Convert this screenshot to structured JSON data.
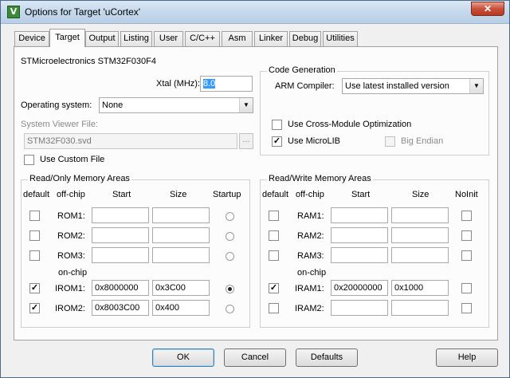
{
  "window": {
    "title": "Options for Target 'uCortex'",
    "icon": "keil-uvision-icon",
    "close_glyph": "✕"
  },
  "tabs": [
    {
      "label": "Device"
    },
    {
      "label": "Target"
    },
    {
      "label": "Output"
    },
    {
      "label": "Listing"
    },
    {
      "label": "User"
    },
    {
      "label": "C/C++"
    },
    {
      "label": "Asm"
    },
    {
      "label": "Linker"
    },
    {
      "label": "Debug"
    },
    {
      "label": "Utilities"
    }
  ],
  "active_tab": "Target",
  "target": {
    "device_name": "STMicroelectronics STM32F030F4",
    "xtal_label": "Xtal (MHz):",
    "xtal_value": "8.0",
    "os_label": "Operating system:",
    "os_value": "None",
    "svf_label": "System Viewer File:",
    "svf_value": "STM32F030.svd",
    "browse_label": "...",
    "custom_file_label": "Use Custom File",
    "custom_file_checked": false
  },
  "code_gen": {
    "title": "Code Generation",
    "compiler_label": "ARM Compiler:",
    "compiler_value": "Use latest installed version",
    "cross_module_label": "Use Cross-Module Optimization",
    "cross_module_checked": false,
    "microlib_label": "Use MicroLIB",
    "microlib_checked": true,
    "big_endian_label": "Big Endian",
    "big_endian_checked": false
  },
  "rom": {
    "title": "Read/Only Memory Areas",
    "headers": {
      "default": "default",
      "offchip": "off-chip",
      "start": "Start",
      "size": "Size",
      "startup": "Startup"
    },
    "onchip_label": "on-chip",
    "rows": [
      {
        "name": "ROM1:",
        "default": false,
        "start": "",
        "size": "",
        "startup": false
      },
      {
        "name": "ROM2:",
        "default": false,
        "start": "",
        "size": "",
        "startup": false
      },
      {
        "name": "ROM3:",
        "default": false,
        "start": "",
        "size": "",
        "startup": false
      },
      {
        "name": "IROM1:",
        "default": true,
        "start": "0x8000000",
        "size": "0x3C00",
        "startup": true
      },
      {
        "name": "IROM2:",
        "default": true,
        "start": "0x8003C00",
        "size": "0x400",
        "startup": false
      }
    ]
  },
  "ram": {
    "title": "Read/Write Memory Areas",
    "headers": {
      "default": "default",
      "offchip": "off-chip",
      "start": "Start",
      "size": "Size",
      "noinit": "NoInit"
    },
    "onchip_label": "on-chip",
    "rows": [
      {
        "name": "RAM1:",
        "default": false,
        "start": "",
        "size": "",
        "noinit": false
      },
      {
        "name": "RAM2:",
        "default": false,
        "start": "",
        "size": "",
        "noinit": false
      },
      {
        "name": "RAM3:",
        "default": false,
        "start": "",
        "size": "",
        "noinit": false
      },
      {
        "name": "IRAM1:",
        "default": true,
        "start": "0x20000000",
        "size": "0x1000",
        "noinit": false
      },
      {
        "name": "IRAM2:",
        "default": false,
        "start": "",
        "size": "",
        "noinit": false
      }
    ]
  },
  "buttons": {
    "ok": "OK",
    "cancel": "Cancel",
    "defaults": "Defaults",
    "help": "Help"
  },
  "check_glyph": "✓",
  "dropdown_glyph": "▼"
}
